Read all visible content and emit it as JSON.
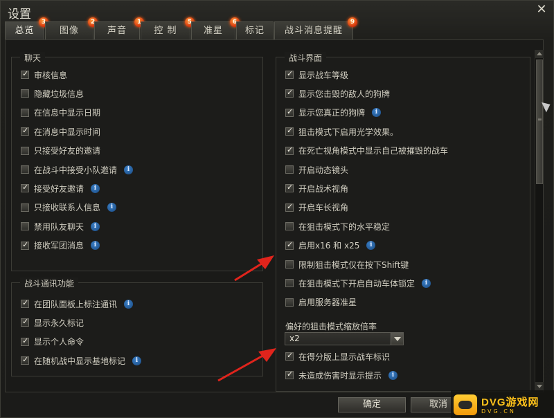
{
  "window": {
    "title": "设置",
    "close_glyph": "✕"
  },
  "tabs": [
    {
      "label": "总览",
      "badge": "3"
    },
    {
      "label": "图像",
      "badge": "2"
    },
    {
      "label": "声音",
      "badge": "1"
    },
    {
      "label": "控 制",
      "badge": "5"
    },
    {
      "label": "准星",
      "badge": "6"
    },
    {
      "label": "标记",
      "badge": ""
    },
    {
      "label": "战斗消息提醒",
      "badge": "9"
    }
  ],
  "groups": {
    "chat": {
      "title": "聊天",
      "items": [
        {
          "label": "审核信息",
          "checked": true,
          "info": false
        },
        {
          "label": "隐藏垃圾信息",
          "checked": false,
          "info": false
        },
        {
          "label": "在信息中显示日期",
          "checked": false,
          "info": false
        },
        {
          "label": "在消息中显示时间",
          "checked": true,
          "info": false
        },
        {
          "label": "只接受好友的邀请",
          "checked": false,
          "info": false
        },
        {
          "label": "在战斗中接受小队邀请",
          "checked": false,
          "info": true
        },
        {
          "label": "接受好友邀请",
          "checked": true,
          "info": true
        },
        {
          "label": "只接收联系人信息",
          "checked": false,
          "info": true
        },
        {
          "label": "禁用队友聊天",
          "checked": false,
          "info": true
        },
        {
          "label": "接收军团消息",
          "checked": true,
          "info": true
        }
      ]
    },
    "comms": {
      "title": "战斗通讯功能",
      "items": [
        {
          "label": "在团队面板上标注通讯",
          "checked": true,
          "info": true
        },
        {
          "label": "显示永久标记",
          "checked": true,
          "info": false
        },
        {
          "label": "显示个人命令",
          "checked": true,
          "info": false
        },
        {
          "label": "在随机战中显示基地标记",
          "checked": true,
          "info": true
        }
      ]
    },
    "battle": {
      "title": "战斗界面",
      "items": [
        {
          "label": "显示战车等级",
          "checked": true,
          "info": false
        },
        {
          "label": "显示您击毁的敌人的狗牌",
          "checked": true,
          "info": false
        },
        {
          "label": "显示您真正的狗牌",
          "checked": true,
          "info": true
        },
        {
          "label": "狙击模式下启用光学效果。",
          "checked": true,
          "info": false
        },
        {
          "label": "在死亡视角模式中显示自己被摧毁的战车",
          "checked": true,
          "info": false
        },
        {
          "label": "开启动态镜头",
          "checked": false,
          "info": false
        },
        {
          "label": "开启战术视角",
          "checked": true,
          "info": false
        },
        {
          "label": "开启车长视角",
          "checked": true,
          "info": false
        },
        {
          "label": "在狙击模式下的水平稳定",
          "checked": false,
          "info": false
        },
        {
          "label": "启用x16 和 x25",
          "checked": true,
          "info": true
        },
        {
          "label": "限制狙击模式仅在按下Shift键",
          "checked": false,
          "info": false
        },
        {
          "label": "在狙击模式下开启自动车体锁定",
          "checked": false,
          "info": true
        },
        {
          "label": "启用服务器准星",
          "checked": false,
          "info": false
        }
      ],
      "zoom_label": "偏好的狙击模式缩放倍率",
      "zoom_value": "x2",
      "items_after": [
        {
          "label": "在得分版上显示战车标识",
          "checked": true,
          "info": false
        },
        {
          "label": "未造成伤害时显示提示",
          "checked": true,
          "info": true
        }
      ]
    }
  },
  "buttons": {
    "ok": "确定",
    "cancel": "取消"
  },
  "info_glyph": "i",
  "watermark": {
    "main": "DVG游戏网",
    "sub": "DVG.CN"
  },
  "colors": {
    "badge": "#e0400e",
    "info": "#2a6fb5",
    "arrow": "#e0241c",
    "accent_yellow": "#ffc21a"
  }
}
